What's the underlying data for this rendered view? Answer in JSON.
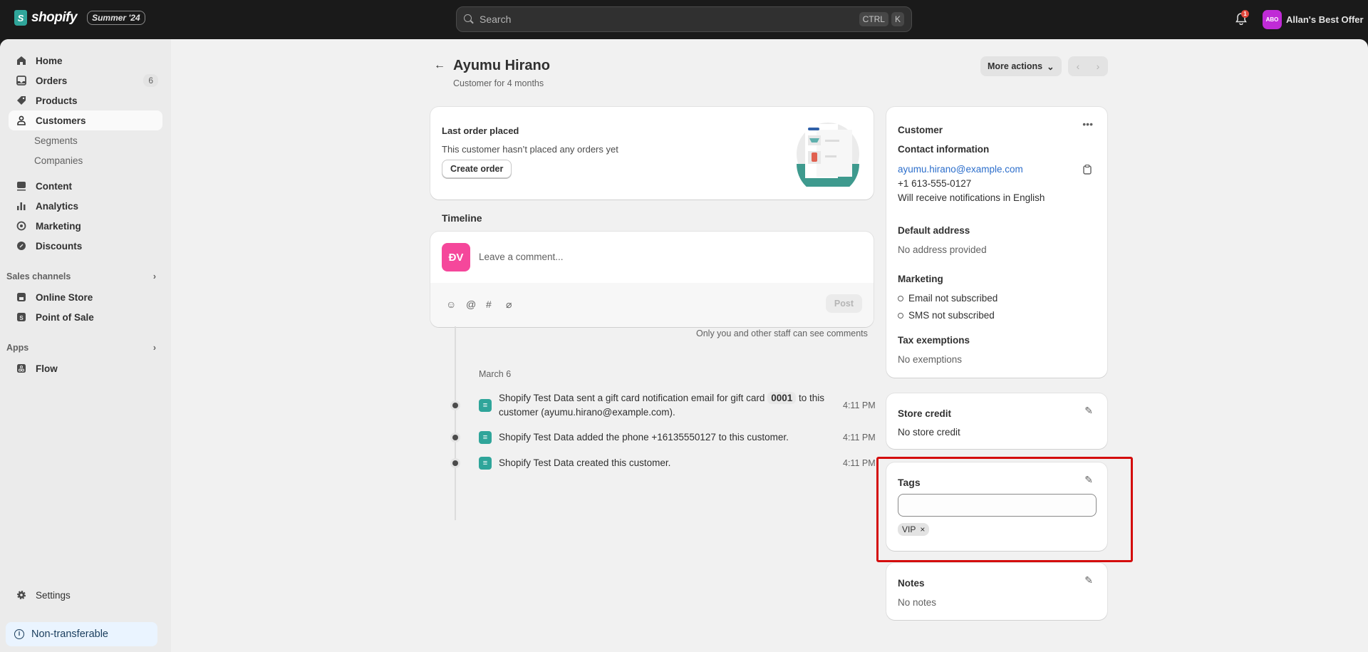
{
  "topbar": {
    "brand": "shopify",
    "edition": "Summer '24",
    "search_placeholder": "Search",
    "shortcut_keys": [
      "CTRL",
      "K"
    ],
    "notification_count": "1",
    "store_initials": "ABO",
    "store_name": "Allan's Best Offer",
    "store_color": "#c02bd6"
  },
  "sidebar": {
    "items": [
      {
        "label": "Home",
        "icon": "home-icon"
      },
      {
        "label": "Orders",
        "icon": "inbox-icon",
        "badge": "6"
      },
      {
        "label": "Products",
        "icon": "tag-icon"
      },
      {
        "label": "Customers",
        "icon": "person-icon",
        "active": true
      },
      {
        "label": "Content",
        "icon": "content-icon"
      },
      {
        "label": "Analytics",
        "icon": "bar-chart-icon"
      },
      {
        "label": "Marketing",
        "icon": "target-icon"
      },
      {
        "label": "Discounts",
        "icon": "discount-icon"
      }
    ],
    "customer_subitems": [
      "Segments",
      "Companies"
    ],
    "sales_channels": {
      "title": "Sales channels",
      "items": [
        {
          "label": "Online Store",
          "icon": "store-icon"
        },
        {
          "label": "Point of Sale",
          "icon": "pos-icon"
        }
      ]
    },
    "apps": {
      "title": "Apps",
      "items": [
        {
          "label": "Flow",
          "icon": "flow-icon"
        }
      ]
    },
    "settings_label": "Settings",
    "non_transferable_label": "Non-transferable"
  },
  "page": {
    "title": "Ayumu Hirano",
    "subtitle": "Customer for 4 months",
    "more_actions_label": "More actions"
  },
  "last_order": {
    "heading": "Last order placed",
    "message": "This customer hasn’t placed any orders yet",
    "create_order_label": "Create order"
  },
  "timeline": {
    "title": "Timeline",
    "avatar_initials": "ĐV",
    "avatar_color": "#f5479b",
    "comment_placeholder": "Leave a comment...",
    "post_label": "Post",
    "staff_note": "Only you and other staff can see comments",
    "date": "March 6",
    "events": [
      {
        "text_before": "Shopify Test Data sent a gift card notification email for gift card",
        "chip": "0001",
        "text_after": "to this customer (ayumu.hirano@example.com).",
        "time": "4:11 PM"
      },
      {
        "text": "Shopify Test Data added the phone +16135550127 to this customer.",
        "time": "4:11 PM"
      },
      {
        "text": "Shopify Test Data created this customer.",
        "time": "4:11 PM"
      }
    ]
  },
  "customer_card": {
    "heading": "Customer",
    "contact_heading": "Contact information",
    "email": "ayumu.hirano@example.com",
    "phone": "+1 613-555-0127",
    "language_note": "Will receive notifications in English",
    "address_heading": "Default address",
    "address_value": "No address provided",
    "marketing_heading": "Marketing",
    "email_marketing": "Email not subscribed",
    "sms_marketing": "SMS not subscribed",
    "tax_heading": "Tax exemptions",
    "tax_value": "No exemptions"
  },
  "store_credit": {
    "heading": "Store credit",
    "value": "No store credit"
  },
  "tags": {
    "heading": "Tags",
    "input_value": "",
    "items": [
      "VIP"
    ]
  },
  "notes": {
    "heading": "Notes",
    "value": "No notes"
  }
}
